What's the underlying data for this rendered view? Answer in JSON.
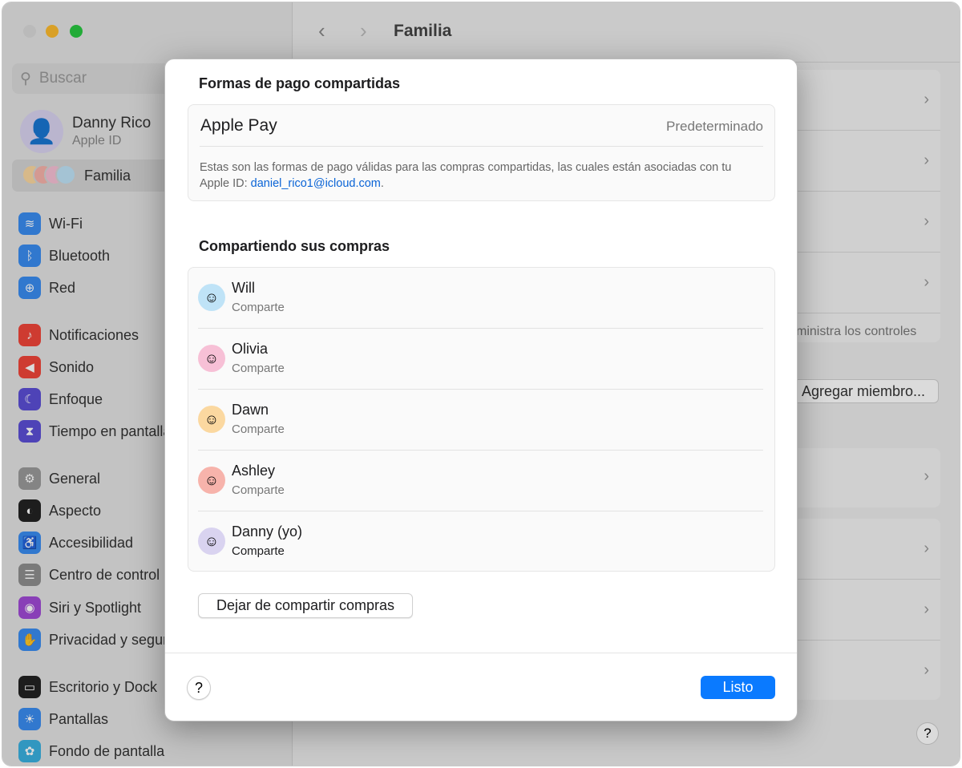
{
  "window": {
    "title": "Familia",
    "traffic": {
      "close": "#d9d9d9",
      "min": "#fdbb2e",
      "max": "#28c840"
    }
  },
  "sidebar": {
    "search_placeholder": "Buscar",
    "user": {
      "name": "Danny Rico",
      "sub": "Apple ID"
    },
    "family": "Familia",
    "items": [
      {
        "label": "Wi-Fi",
        "icon": "wifi-icon",
        "color": "#3a8cf0",
        "glyph": "≋"
      },
      {
        "label": "Bluetooth",
        "icon": "bluetooth-icon",
        "color": "#3a8cf0",
        "glyph": "ᛒ"
      },
      {
        "label": "Red",
        "icon": "globe-icon",
        "color": "#3a8cf0",
        "glyph": "⊕"
      },
      {
        "label": "Notificaciones",
        "icon": "bell-icon",
        "color": "#f0453a",
        "glyph": "♪"
      },
      {
        "label": "Sonido",
        "icon": "speaker-icon",
        "color": "#f0453a",
        "glyph": "◀"
      },
      {
        "label": "Enfoque",
        "icon": "moon-icon",
        "color": "#5b4fd6",
        "glyph": "☾"
      },
      {
        "label": "Tiempo en pantalla",
        "icon": "hourglass-icon",
        "color": "#5b4fd6",
        "glyph": "⧗"
      },
      {
        "label": "General",
        "icon": "gear-icon",
        "color": "#9a9a9a",
        "glyph": "⚙"
      },
      {
        "label": "Aspecto",
        "icon": "appearance-icon",
        "color": "#222222",
        "glyph": "◐"
      },
      {
        "label": "Accesibilidad",
        "icon": "accessibility-icon",
        "color": "#3a8cf0",
        "glyph": "♿"
      },
      {
        "label": "Centro de control",
        "icon": "control-center-icon",
        "color": "#8e8e8e",
        "glyph": "☰"
      },
      {
        "label": "Siri y Spotlight",
        "icon": "siri-icon",
        "color": "#a04ad6",
        "glyph": "◉"
      },
      {
        "label": "Privacidad y seguridad",
        "icon": "hand-icon",
        "color": "#3a8cf0",
        "glyph": "✋"
      },
      {
        "label": "Escritorio y Dock",
        "icon": "dock-icon",
        "color": "#222222",
        "glyph": "▭"
      },
      {
        "label": "Pantallas",
        "icon": "sun-icon",
        "color": "#3a8cf0",
        "glyph": "☀"
      },
      {
        "label": "Fondo de pantalla",
        "icon": "wallpaper-icon",
        "color": "#3ab0e0",
        "glyph": "✿"
      }
    ]
  },
  "main": {
    "partial_text": "ministra los controles",
    "add_member": "Agregar miembro..."
  },
  "modal": {
    "payment_title": "Formas de pago compartidas",
    "apple_pay": "Apple Pay",
    "default": "Predeterminado",
    "desc": "Estas son las formas de pago válidas para las compras compartidas, las cuales están asociadas con tu Apple ID: ",
    "email": "daniel_rico1@icloud.com",
    "desc_end": ".",
    "sharing_title": "Compartiendo sus compras",
    "members": [
      {
        "name": "Will",
        "status": "Comparte",
        "bg": "#bfe3f7"
      },
      {
        "name": "Olivia",
        "status": "Comparte",
        "bg": "#f7c0d6"
      },
      {
        "name": "Dawn",
        "status": "Comparte",
        "bg": "#fbd8a0"
      },
      {
        "name": "Ashley",
        "status": "Comparte",
        "bg": "#f7b3ab"
      },
      {
        "name": "Danny (yo)",
        "status": "Comparte",
        "bg": "#d9d3f0"
      }
    ],
    "stop_sharing": "Dejar de compartir compras",
    "help": "?",
    "done": "Listo",
    "accent": "#0a7aff"
  }
}
